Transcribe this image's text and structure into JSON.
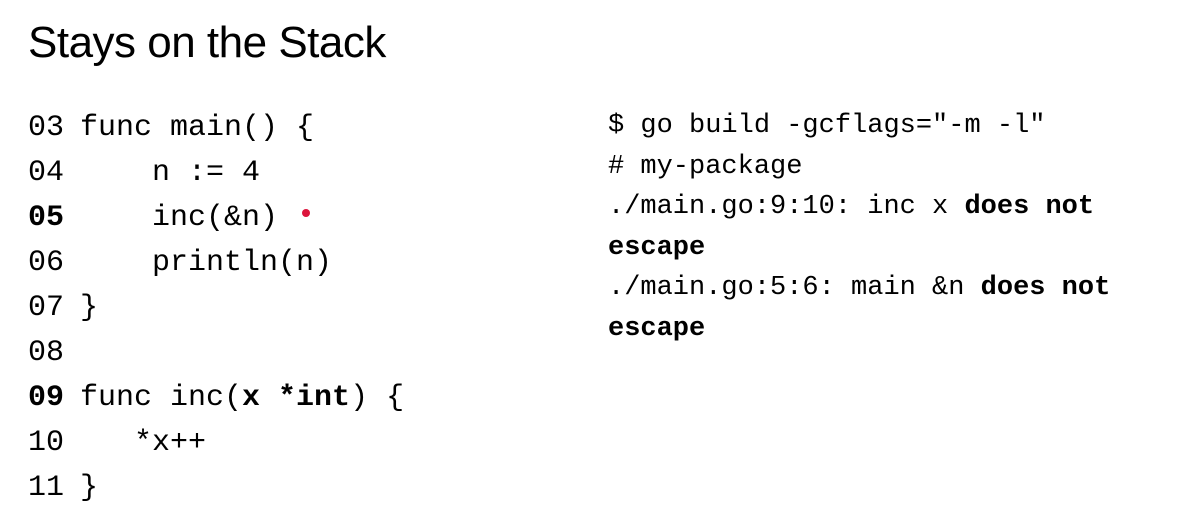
{
  "title": "Stays on the Stack",
  "code_lines": [
    {
      "num": "03",
      "bold_num": false,
      "prefix": "",
      "code": "func main() {",
      "bold_tokens": [],
      "marker": false
    },
    {
      "num": "04",
      "bold_num": false,
      "prefix": "    ",
      "code": "n := 4",
      "bold_tokens": [],
      "marker": false
    },
    {
      "num": "05",
      "bold_num": true,
      "prefix": "    ",
      "code": "inc(&n)",
      "bold_tokens": [],
      "marker": true
    },
    {
      "num": "06",
      "bold_num": false,
      "prefix": "    ",
      "code": "println(n)",
      "bold_tokens": [],
      "marker": false
    },
    {
      "num": "07",
      "bold_num": false,
      "prefix": "",
      "code": "}",
      "bold_tokens": [],
      "marker": false
    },
    {
      "num": "08",
      "bold_num": false,
      "prefix": "",
      "code": "",
      "bold_tokens": [],
      "marker": false
    },
    {
      "num": "09",
      "bold_num": true,
      "prefix": "",
      "code_pre": "func inc(",
      "code_bold": "x *int",
      "code_post": ") {",
      "bold_tokens": [
        "x *int"
      ],
      "marker": false
    },
    {
      "num": "10",
      "bold_num": false,
      "prefix": "   ",
      "code": "*x++",
      "bold_tokens": [],
      "marker": false
    },
    {
      "num": "11",
      "bold_num": false,
      "prefix": "",
      "code": "}",
      "bold_tokens": [],
      "marker": false
    }
  ],
  "terminal": {
    "cmd": "$ go build -gcflags=\"-m -l\"",
    "pkg": "# my-package",
    "line1_pre": "./main.go:9:10: inc x ",
    "line1_bold": "does not escape",
    "line2_pre": "./main.go:5:6: main &n ",
    "line2_bold": "does not escape"
  }
}
